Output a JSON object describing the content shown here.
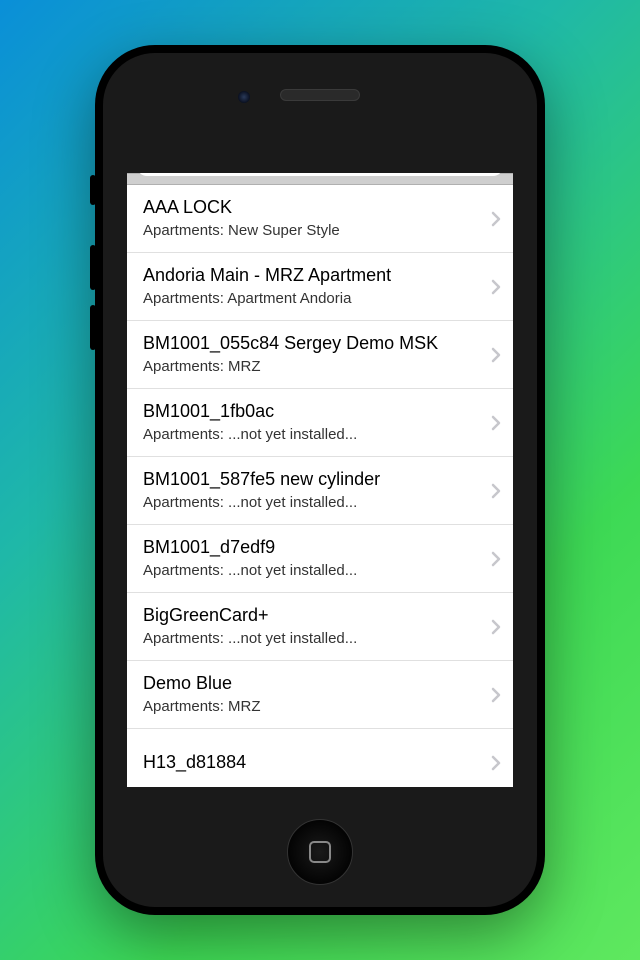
{
  "list": {
    "subtitle_prefix": "Apartments: ",
    "items": [
      {
        "title": "AAA LOCK",
        "subtitle": "Apartments: New Super Style"
      },
      {
        "title": "Andoria Main - MRZ Apartment",
        "subtitle": "Apartments: Apartment Andoria"
      },
      {
        "title": "BM1001_055c84 Sergey Demo MSK",
        "subtitle": "Apartments: MRZ"
      },
      {
        "title": "BM1001_1fb0ac",
        "subtitle": "Apartments: ...not yet installed..."
      },
      {
        "title": "BM1001_587fe5 new cylinder",
        "subtitle": "Apartments: ...not yet installed..."
      },
      {
        "title": "BM1001_d7edf9",
        "subtitle": "Apartments: ...not yet installed..."
      },
      {
        "title": "BigGreenCard+",
        "subtitle": "Apartments: ...not yet installed..."
      },
      {
        "title": "Demo Blue",
        "subtitle": "Apartments: MRZ"
      },
      {
        "title": "H13_d81884",
        "subtitle": ""
      }
    ]
  }
}
